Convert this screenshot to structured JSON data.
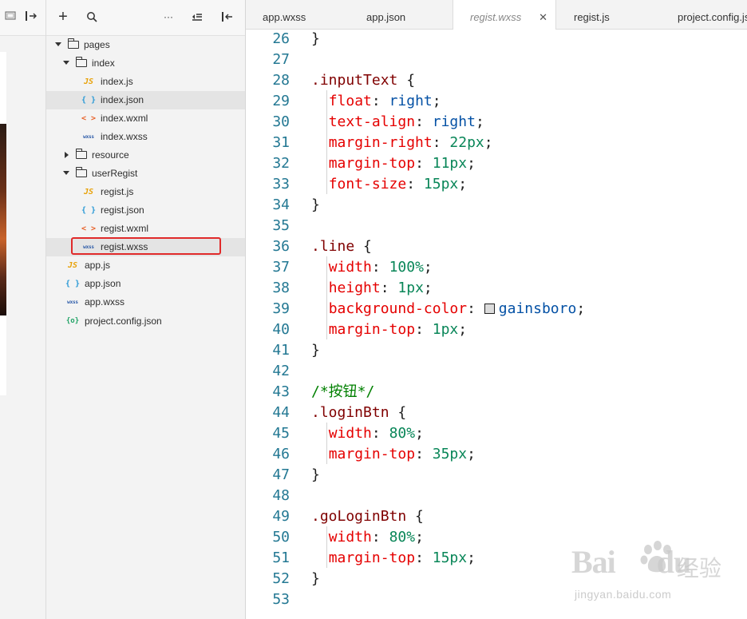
{
  "tabs": [
    {
      "label": "app.wxss"
    },
    {
      "label": "app.json"
    },
    {
      "label": "regist.wxss",
      "active": true,
      "close_glyph": "✕"
    },
    {
      "label": "regist.js"
    },
    {
      "label": "project.config.js"
    }
  ],
  "explorer": {
    "toolbar": {
      "add": "+",
      "search": "search-icon",
      "more": "···"
    },
    "tree": [
      {
        "label": "pages",
        "type": "folder",
        "expanded": true
      },
      {
        "label": "index",
        "type": "folder",
        "expanded": true
      },
      {
        "label": "index.js",
        "icon": "JS"
      },
      {
        "label": "index.json",
        "icon": "{ }",
        "selected": true
      },
      {
        "label": "index.wxml",
        "icon": "< >"
      },
      {
        "label": "index.wxss",
        "icon": "wxss"
      },
      {
        "label": "resource",
        "type": "folder",
        "expanded": false
      },
      {
        "label": "userRegist",
        "type": "folder",
        "expanded": true
      },
      {
        "label": "regist.js",
        "icon": "JS"
      },
      {
        "label": "regist.json",
        "icon": "{ }"
      },
      {
        "label": "regist.wxml",
        "icon": "< >"
      },
      {
        "label": "regist.wxss",
        "icon": "wxss",
        "selected": true,
        "highlighted": true
      },
      {
        "label": "app.js",
        "icon": "JS"
      },
      {
        "label": "app.json",
        "icon": "{ }"
      },
      {
        "label": "app.wxss",
        "icon": "wxss"
      },
      {
        "label": "project.config.json",
        "icon": "{o}"
      }
    ]
  },
  "editor": {
    "lines": [
      {
        "n": "26",
        "text": "}"
      },
      {
        "n": "27",
        "text": ""
      },
      {
        "n": "28",
        "text": ".inputText {"
      },
      {
        "n": "29",
        "prop": "float",
        "value": "right"
      },
      {
        "n": "30",
        "prop": "text-align",
        "value": "right"
      },
      {
        "n": "31",
        "prop": "margin-right",
        "value": "22px"
      },
      {
        "n": "32",
        "prop": "margin-top",
        "value": "11px"
      },
      {
        "n": "33",
        "prop": "font-size",
        "value": "15px"
      },
      {
        "n": "34",
        "text": "}"
      },
      {
        "n": "35",
        "text": ""
      },
      {
        "n": "36",
        "text": ".line {"
      },
      {
        "n": "37",
        "prop": "width",
        "value": "100%"
      },
      {
        "n": "38",
        "prop": "height",
        "value": "1px"
      },
      {
        "n": "39",
        "prop": "background-color",
        "value": "gainsboro"
      },
      {
        "n": "40",
        "prop": "margin-top",
        "value": "1px"
      },
      {
        "n": "41",
        "text": "}"
      },
      {
        "n": "42",
        "text": ""
      },
      {
        "n": "43",
        "text": "/*按钮*/"
      },
      {
        "n": "44",
        "text": ".loginBtn {"
      },
      {
        "n": "45",
        "prop": "width",
        "value": "80%"
      },
      {
        "n": "46",
        "prop": "margin-top",
        "value": "35px"
      },
      {
        "n": "47",
        "text": "}"
      },
      {
        "n": "48",
        "text": ""
      },
      {
        "n": "49",
        "text": ".goLoginBtn {"
      },
      {
        "n": "50",
        "prop": "width",
        "value": "80%"
      },
      {
        "n": "51",
        "prop": "margin-top",
        "value": "15px"
      },
      {
        "n": "52",
        "text": "}"
      },
      {
        "n": "53",
        "text": ""
      }
    ]
  },
  "watermark": {
    "brand": "Bai",
    "brand2": "du",
    "cn": "经验",
    "url": "jingyan.baidu.com"
  },
  "colors": {
    "highlight_box": "#e02a2a",
    "line_number": "#237893",
    "property": "#e50000",
    "value_keyword": "#0451a5",
    "value_number": "#098658",
    "selector": "#800000",
    "comment": "#008000",
    "swatch": "#dcdcdc"
  }
}
